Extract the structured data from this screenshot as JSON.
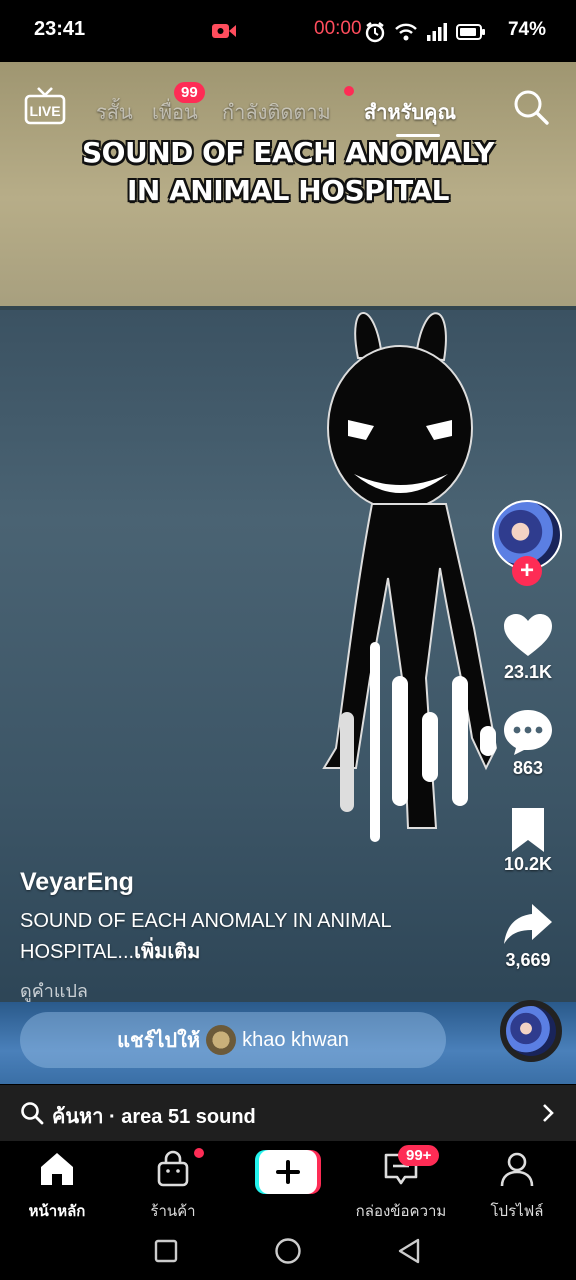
{
  "status_bar": {
    "time": "23:41",
    "recording_time": "00:00",
    "battery": "74%"
  },
  "top_nav": {
    "live_label": "LIVE",
    "tabs": [
      {
        "label": "รสั้น"
      },
      {
        "label": "เพื่อน",
        "badge": "99"
      },
      {
        "label": "กำลังติดตาม"
      },
      {
        "label": "สำหรับคุณ",
        "active": true
      }
    ]
  },
  "video": {
    "overlay_title": "SOUND OF EACH ANOMALY\nIN ANIMAL HOSPITAL"
  },
  "right_rail": {
    "likes": "23.1K",
    "comments": "863",
    "bookmarks": "10.2K",
    "shares": "3,669"
  },
  "caption": {
    "author": "VeyarEng",
    "text": "SOUND OF EACH ANOMALY IN ANIMAL HOSPITAL...",
    "more": "เพิ่มเติม",
    "translate": "ดูคำแปล"
  },
  "share_pill": {
    "prefix": "แชร์ไปให้",
    "name": "khao khwan"
  },
  "search_bar": {
    "label": "ค้นหา",
    "query": "area 51 sound",
    "separator": " · "
  },
  "bottom_nav": {
    "home": "หน้าหลัก",
    "shop": "ร้านค้า",
    "inbox": "กล่องข้อความ",
    "inbox_badge": "99+",
    "profile": "โปรไฟล์"
  },
  "colors": {
    "accent": "#fe2c55",
    "search_bg": "#1f1f1f"
  }
}
